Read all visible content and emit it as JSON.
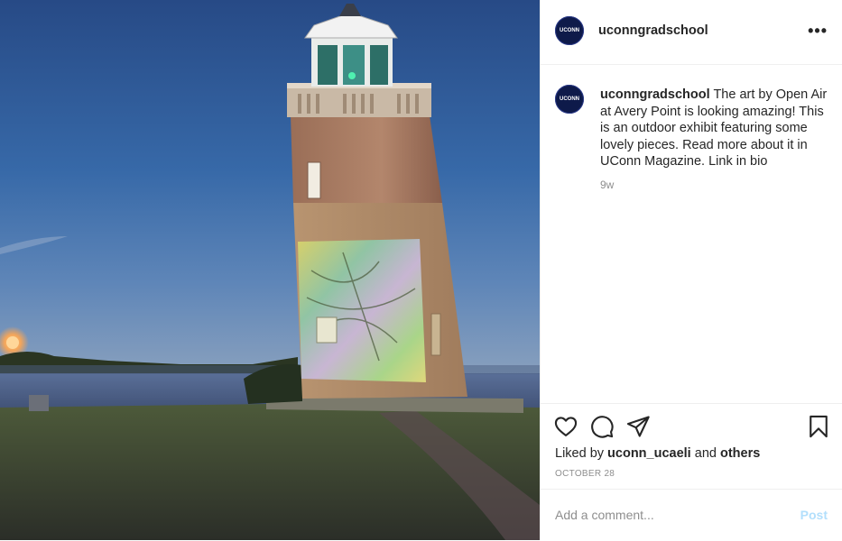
{
  "post": {
    "username": "uconngradschool",
    "avatar_text": "UCONN",
    "more_icon": "more-horizontal-icon",
    "caption_text": "The art by Open Air at Avery Point is looking amazing! This is an outdoor exhibit featuring some lovely pieces. Read more about it in UConn Magazine. Link in bio",
    "age": "9w"
  },
  "actions": {
    "icons": [
      "heart-icon",
      "comment-icon",
      "share-icon",
      "bookmark-icon"
    ],
    "liked_by_prefix": "Liked by",
    "liked_by_user": "uconn_ucaeli",
    "liked_by_and": "and",
    "liked_by_others": "others",
    "date": "OCTOBER 28"
  },
  "comment": {
    "placeholder": "Add a comment...",
    "post_label": "Post"
  },
  "colors": {
    "avatar_bg": "#0e1a4a",
    "post_disabled": "#b2dffc",
    "muted": "#8e8e8e"
  }
}
